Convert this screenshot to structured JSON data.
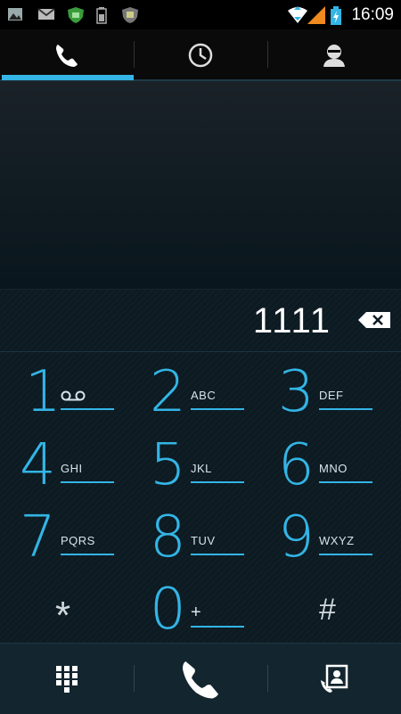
{
  "status_bar": {
    "time": "16:09",
    "icons": [
      "image-icon",
      "gmail-icon",
      "shield-icon",
      "battery-small-icon",
      "badge-icon",
      "wifi-icon",
      "signal-icon",
      "battery-charging-icon"
    ]
  },
  "tabs": [
    {
      "name": "phone",
      "icon": "phone-icon",
      "selected": true
    },
    {
      "name": "call-log",
      "icon": "clock-icon",
      "selected": false
    },
    {
      "name": "contacts",
      "icon": "person-icon",
      "selected": false
    }
  ],
  "dial": {
    "entered_number": "1111"
  },
  "keys": [
    {
      "digit": "1",
      "letters": "",
      "voicemail": true
    },
    {
      "digit": "2",
      "letters": "ABC"
    },
    {
      "digit": "3",
      "letters": "DEF"
    },
    {
      "digit": "4",
      "letters": "GHI"
    },
    {
      "digit": "5",
      "letters": "JKL"
    },
    {
      "digit": "6",
      "letters": "MNO"
    },
    {
      "digit": "7",
      "letters": "PQRS"
    },
    {
      "digit": "8",
      "letters": "TUV"
    },
    {
      "digit": "9",
      "letters": "WXYZ"
    },
    {
      "digit": "*",
      "letters": ""
    },
    {
      "digit": "0",
      "letters": "+"
    },
    {
      "digit": "#",
      "letters": ""
    }
  ],
  "bottom_bar": {
    "buttons": [
      "dialpad-icon",
      "call-icon",
      "contact-card-icon"
    ]
  },
  "colors": {
    "accent": "#33b5e5",
    "background": "#0c1a22"
  }
}
